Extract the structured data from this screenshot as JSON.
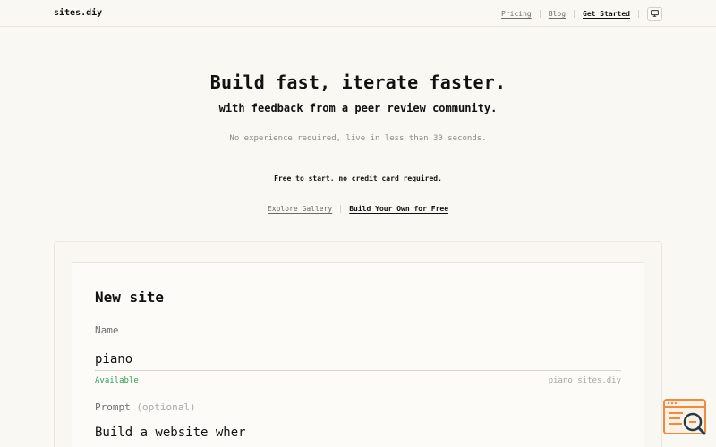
{
  "header": {
    "logo": "sites.diy",
    "nav": {
      "pricing": "Pricing",
      "blog": "Blog",
      "get_started": "Get Started"
    },
    "display_toggle_icon": "monitor-icon"
  },
  "hero": {
    "title": "Build fast, iterate faster.",
    "subtitle": "with feedback from a peer review community.",
    "description": "No experience required, live in less than 30 seconds.",
    "free_note": "Free to start, no credit card required.",
    "explore_link": "Explore Gallery",
    "build_link": "Build Your Own for Free"
  },
  "form": {
    "title": "New site",
    "name_label": "Name",
    "name_value": "piano",
    "availability": "Available",
    "domain_preview": "piano.sites.diy",
    "prompt_label": "Prompt",
    "prompt_optional": "(optional)",
    "prompt_value": "Build a website wher"
  },
  "widget": {
    "icon": "search-window-icon"
  },
  "colors": {
    "background": "#faf8f3",
    "text": "#1a1a1a",
    "muted": "#8a8a8a",
    "available": "#2e9e54",
    "widget_accent": "#f08a3c",
    "widget_dark": "#1f3d4a"
  }
}
